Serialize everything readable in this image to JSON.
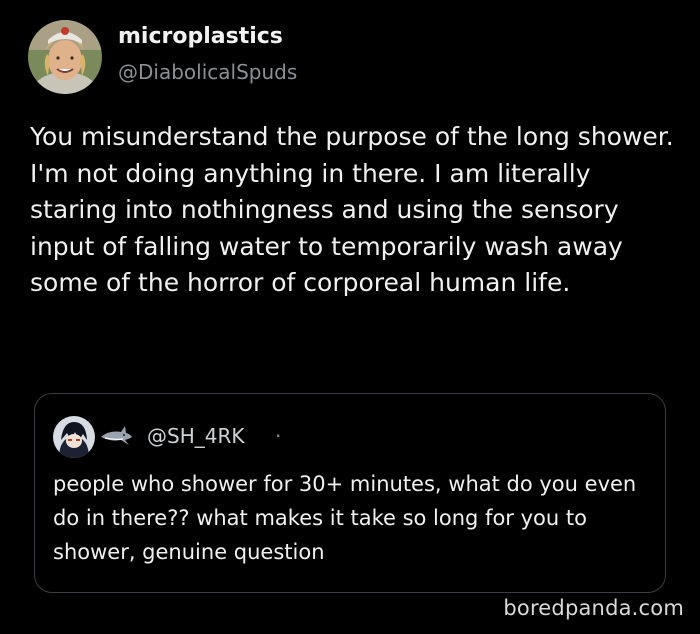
{
  "post": {
    "display_name": "microplastics",
    "handle": "@DiabolicalSpuds",
    "text": "You misunderstand the purpose of the long shower. I'm not doing anything in there. I am literally staring into nothingness and using the sensory input of falling water to temporarily wash away some of the horror of corporeal human life."
  },
  "quote": {
    "handle": "@SH_4RK",
    "separator": "·",
    "text": "people who shower for 30+ minutes, what do you even do in there?? what makes it take so long for you to shower, genuine question"
  },
  "watermark": "boredpanda.com",
  "icons": {
    "avatar": "user-avatar-icon",
    "quote_avatar": "anime-avatar-icon",
    "shark": "shark-icon"
  },
  "colors": {
    "background": "#000000",
    "text": "#f0f0f0",
    "muted": "#8b9095",
    "card_border": "#3a3d41"
  }
}
